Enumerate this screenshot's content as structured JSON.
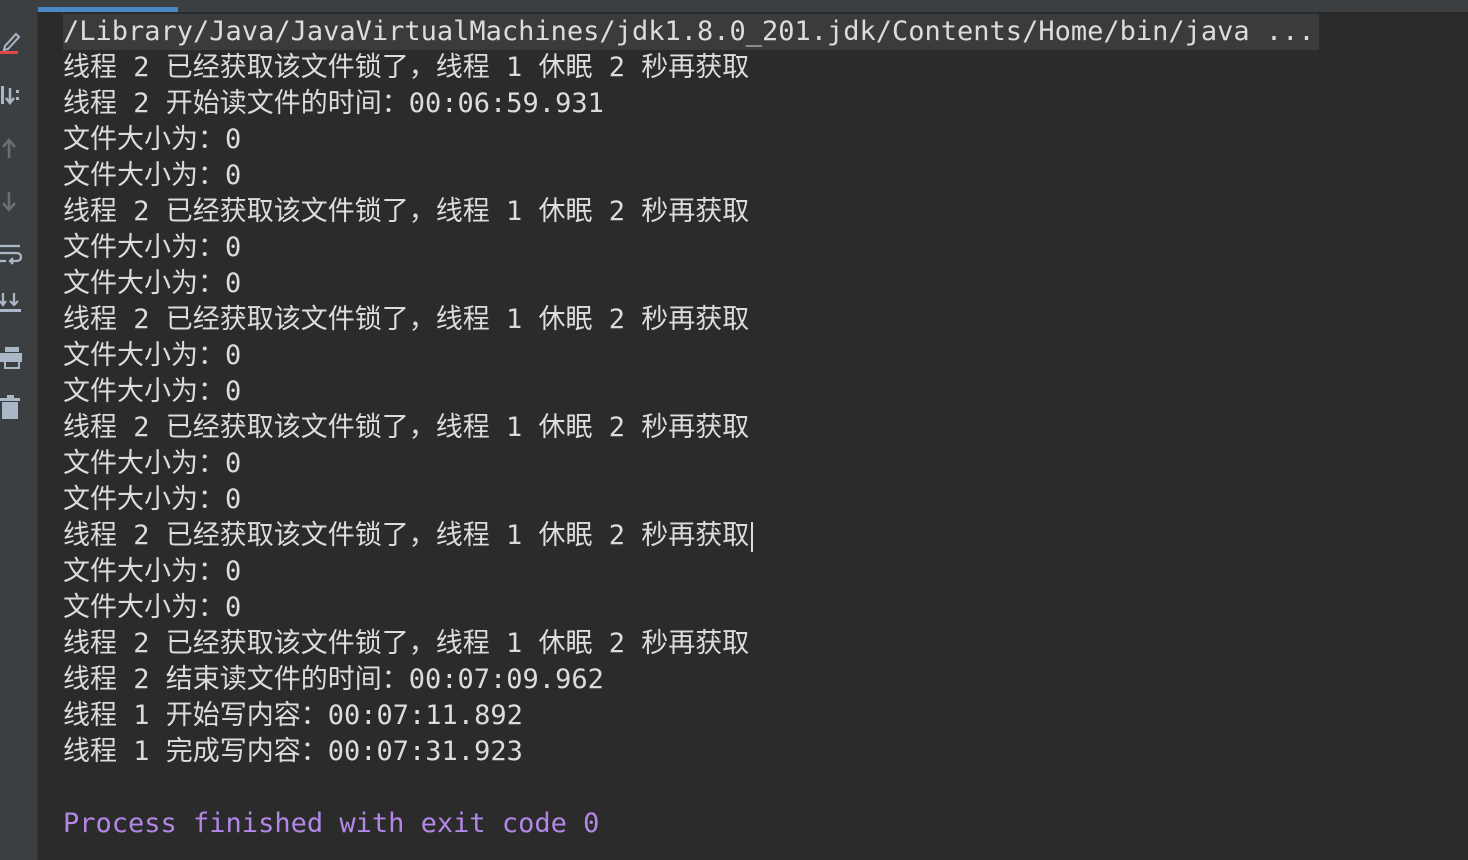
{
  "console": {
    "command": "/Library/Java/JavaVirtualMachines/jdk1.8.0_201.jdk/Contents/Home/bin/java ...",
    "lines": [
      "线程 2 已经获取该文件锁了，线程 1 休眠 2 秒再获取",
      "线程 2 开始读文件的时间：00:06:59.931",
      "文件大小为：0",
      "文件大小为：0",
      "线程 2 已经获取该文件锁了，线程 1 休眠 2 秒再获取",
      "文件大小为：0",
      "文件大小为：0",
      "线程 2 已经获取该文件锁了，线程 1 休眠 2 秒再获取",
      "文件大小为：0",
      "文件大小为：0",
      "线程 2 已经获取该文件锁了，线程 1 休眠 2 秒再获取",
      "文件大小为：0",
      "文件大小为：0",
      "线程 2 已经获取该文件锁了，线程 1 休眠 2 秒再获取",
      "文件大小为：0",
      "文件大小为：0",
      "线程 2 已经获取该文件锁了，线程 1 休眠 2 秒再获取",
      "线程 2 结束读文件的时间：00:07:09.962",
      "线程 1 开始写内容：00:07:11.892",
      "线程 1 完成写内容：00:07:31.923"
    ],
    "process_message": "Process finished with exit code 0"
  },
  "gutter": {
    "icons": [
      "edit-icon",
      "scroll-to-end-icon",
      "arrow-up-icon",
      "arrow-down-icon",
      "soft-wrap-icon",
      "scroll-down-icon",
      "print-icon",
      "trash-icon"
    ]
  },
  "colors": {
    "background": "#2b2b2b",
    "gutter": "#3c3f41",
    "text": "#dcdcdc",
    "process_message": "#b287e6",
    "accent": "#4a88c7"
  }
}
